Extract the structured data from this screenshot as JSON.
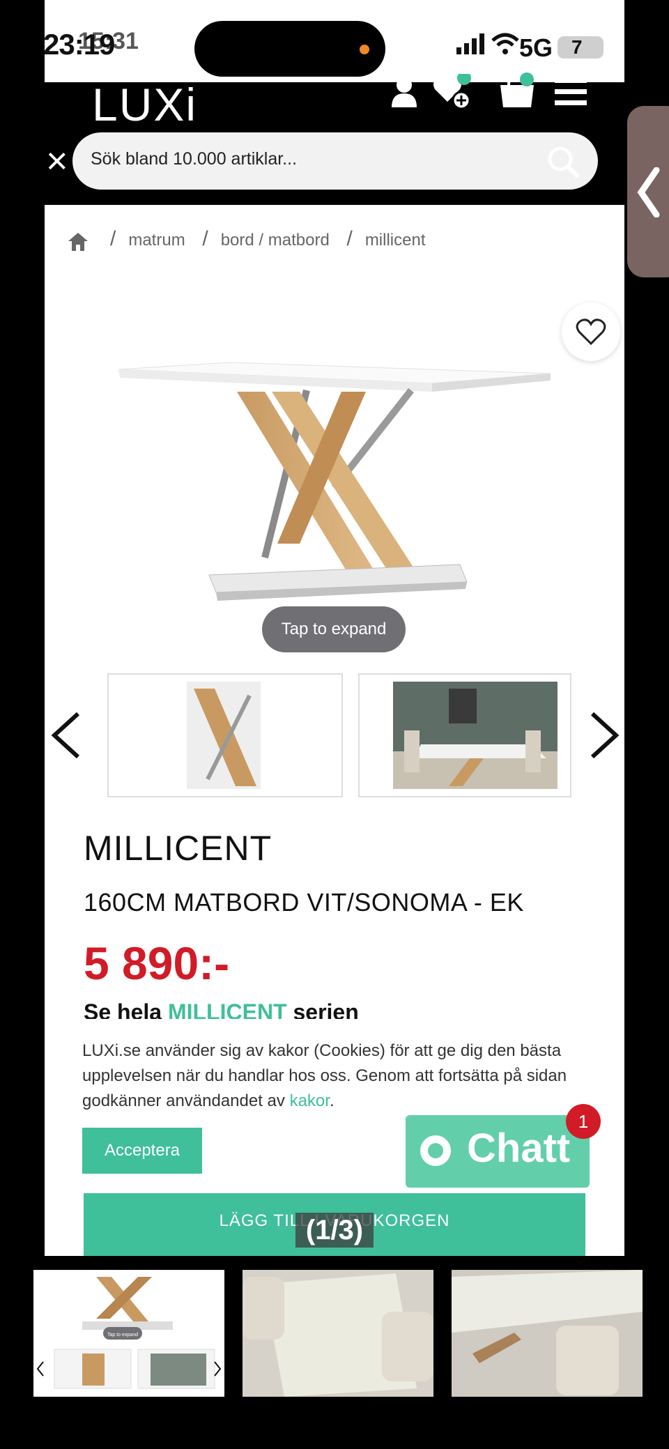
{
  "status_bar": {
    "time": "23:19",
    "time_overlay": "15:31",
    "network": "5G",
    "battery": "7"
  },
  "header": {
    "logo": "LUXi",
    "close_icon": "×"
  },
  "search": {
    "placeholder": "Sök bland 10.000 artiklar..."
  },
  "breadcrumb": {
    "items": [
      "matrum",
      "bord / matbord",
      "millicent"
    ]
  },
  "product": {
    "tap_to_expand": "Tap to expand",
    "title": "MILLICENT",
    "subtitle": "160CM MATBORD VIT/SONOMA - EK",
    "price": "5 890:-",
    "series_prefix": "Se hela ",
    "series_link": "MILLICENT",
    "series_suffix": " serien"
  },
  "cookie": {
    "text": "LUXi.se använder sig av kakor (Cookies) för att ge dig den bästa upplevelsen när du handlar hos oss. Genom att fortsätta på sidan godkänner användandet av ",
    "link": "kakor",
    "end": ".",
    "accept_label": "Acceptera"
  },
  "chat": {
    "label": "Chatt",
    "badge": "1"
  },
  "cart": {
    "label": "LÄGG TILL I VARUKORGEN"
  },
  "gallery": {
    "counter": "(1/3)",
    "thumb_caption": "Tap to expand"
  },
  "colors": {
    "accent": "#3fbf9a",
    "price": "#d11b26",
    "header": "#000000"
  }
}
